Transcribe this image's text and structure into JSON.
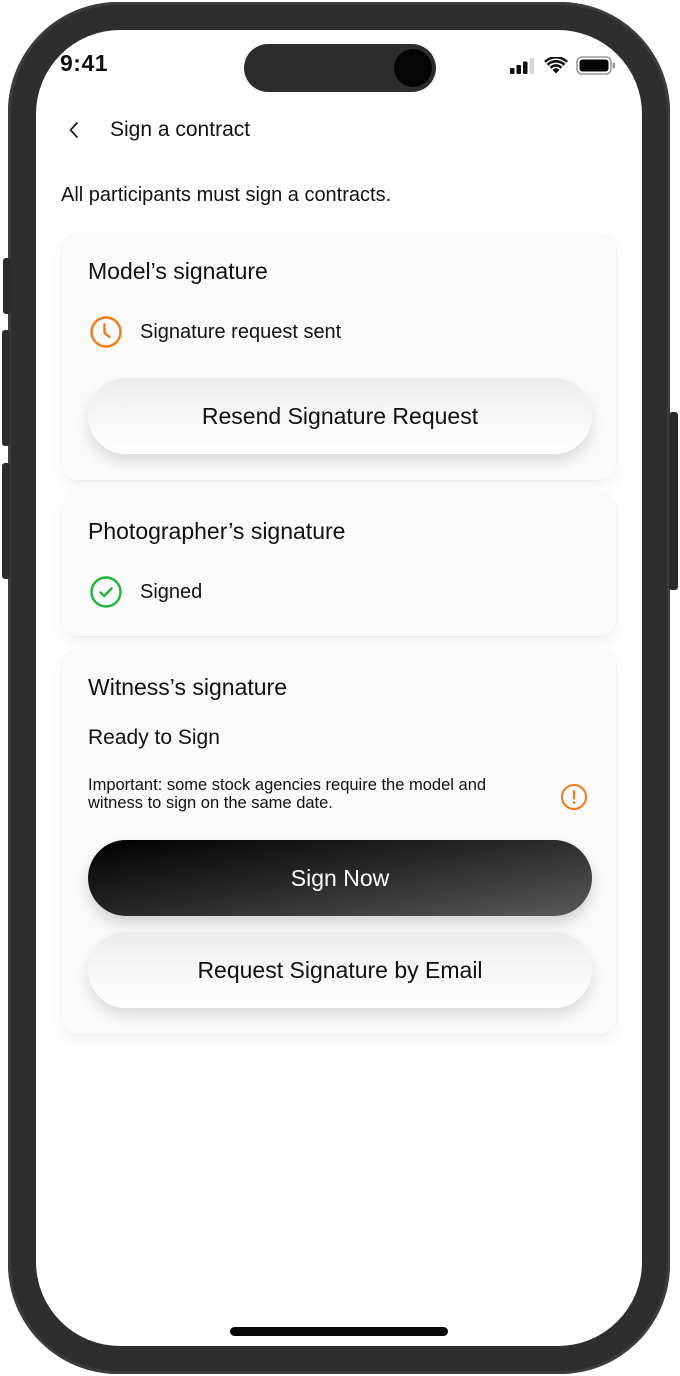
{
  "status_bar": {
    "time": "9:41",
    "icons": [
      "cellular-signal-icon",
      "wifi-icon",
      "battery-icon"
    ]
  },
  "header": {
    "back_icon": "chevron-left-icon",
    "title": "Sign a contract"
  },
  "intro_text": "All participants must sign a contracts.",
  "cards": [
    {
      "title": "Model’s signature",
      "status_icon": "clock-icon",
      "status_text": "Signature request sent",
      "status_color": "#F07A1A",
      "button_label": "Resend Signature Request"
    },
    {
      "title": "Photographer’s signature",
      "status_icon": "check-circle-icon",
      "status_text": "Signed",
      "status_color": "#22B33A"
    },
    {
      "title": "Witness’s signature",
      "status_text": "Ready to Sign",
      "note": "Important: some stock agencies require the model and witness to sign on the same date.",
      "note_icon": "alert-circle-icon",
      "note_color": "#F07A1A",
      "primary_button_label": "Sign Now",
      "secondary_button_label": "Request Signature by Email"
    }
  ]
}
